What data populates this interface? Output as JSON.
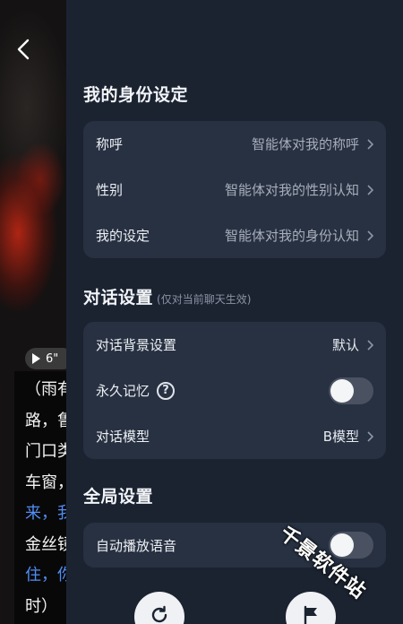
{
  "background_chat": {
    "audio_duration": "6\"",
    "lines": [
      {
        "text": "（雨有",
        "color": "normal"
      },
      {
        "text": "路，鲁",
        "color": "normal"
      },
      {
        "text": "门口类",
        "color": "normal"
      },
      {
        "text": "车窗，",
        "color": "normal"
      },
      {
        "text": "来，我",
        "color": "blue"
      },
      {
        "text": "金丝镜",
        "color": "normal"
      },
      {
        "text": "住，你",
        "color": "blue"
      },
      {
        "text": "时）",
        "color": "normal"
      }
    ]
  },
  "identity": {
    "title": "我的身份设定",
    "rows": [
      {
        "label": "称呼",
        "value": "智能体对我的称呼"
      },
      {
        "label": "性别",
        "value": "智能体对我的性别认知"
      },
      {
        "label": "我的设定",
        "value": "智能体对我的身份认知"
      }
    ]
  },
  "dialog": {
    "title": "对话设置",
    "subtitle": "(仅对当前聊天生效)",
    "background": {
      "label": "对话背景设置",
      "value": "默认"
    },
    "memory": {
      "label": "永久记忆",
      "enabled": false
    },
    "model": {
      "label": "对话模型",
      "value": "B模型"
    }
  },
  "global": {
    "title": "全局设置",
    "autoplay": {
      "label": "自动播放语音",
      "enabled": false
    }
  },
  "watermark": "千景软件站",
  "icons": [
    "back-arrow-icon",
    "play-icon",
    "chevron-right-icon",
    "help-circle-icon",
    "refresh-icon",
    "flag-icon"
  ],
  "colors": {
    "panel": "#1b2331",
    "card": "#273142",
    "accent_blue": "#4f8ff7"
  }
}
